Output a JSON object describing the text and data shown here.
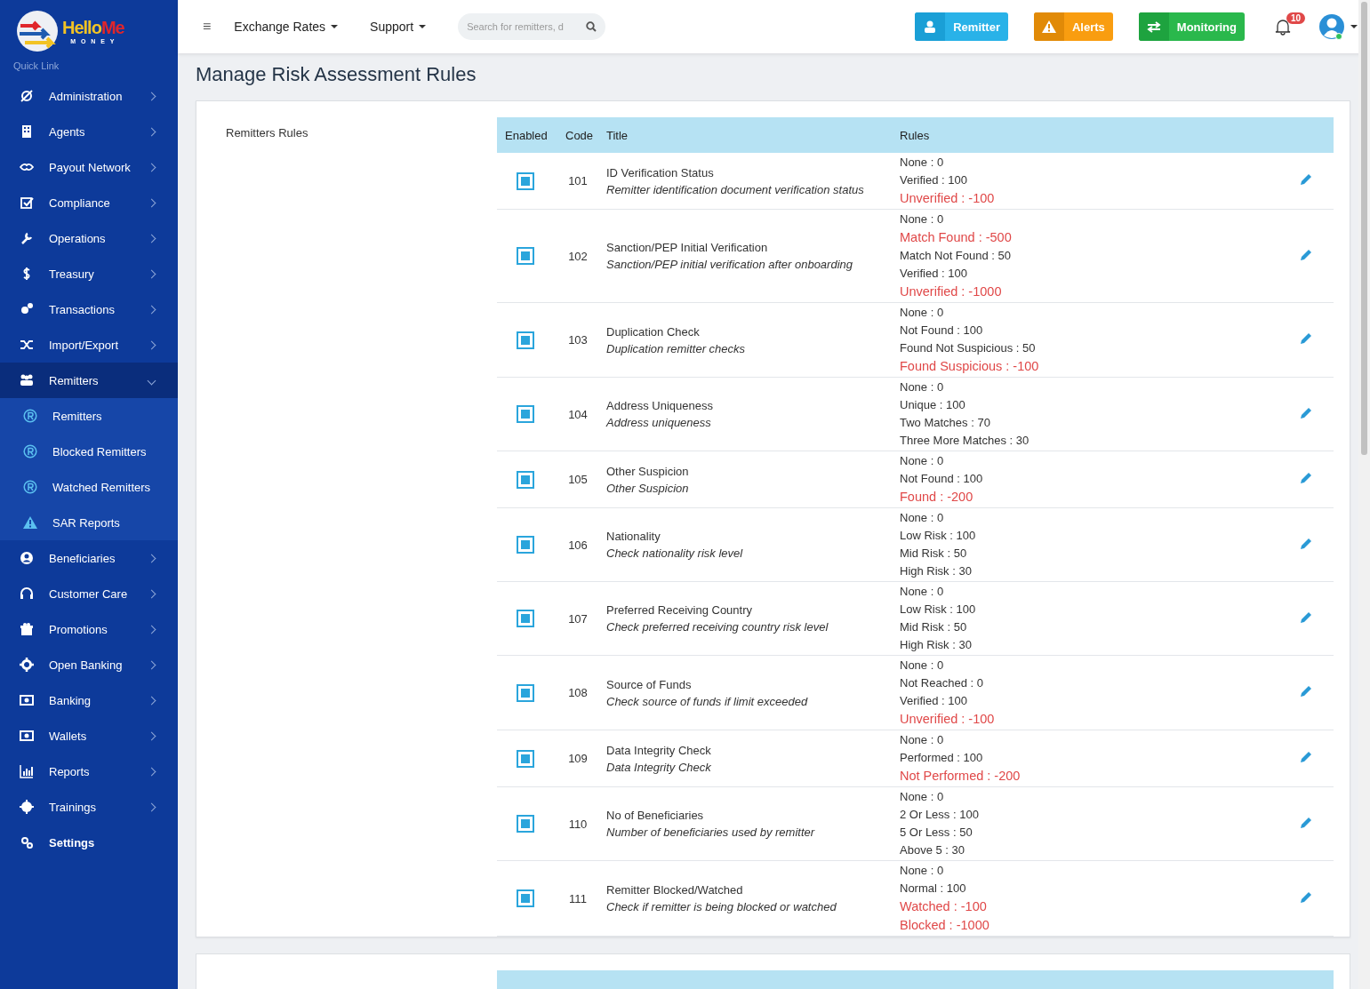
{
  "logo": {
    "name_part1": "Hello",
    "name_part2": "Me",
    "subtitle": "M O N E Y"
  },
  "sidebar": {
    "heading": "Quick Link",
    "items": [
      {
        "label": "Administration",
        "kind": "menu",
        "expanded": false
      },
      {
        "label": "Agents",
        "kind": "menu",
        "expanded": false
      },
      {
        "label": "Payout Network",
        "kind": "menu",
        "expanded": false
      },
      {
        "label": "Compliance",
        "kind": "menu",
        "expanded": false
      },
      {
        "label": "Operations",
        "kind": "menu",
        "expanded": false
      },
      {
        "label": "Treasury",
        "kind": "menu",
        "expanded": false
      },
      {
        "label": "Transactions",
        "kind": "menu",
        "expanded": false
      },
      {
        "label": "Import/Export",
        "kind": "menu",
        "expanded": false
      },
      {
        "label": "Remitters",
        "kind": "menu",
        "expanded": true,
        "children": [
          {
            "label": "Remitters",
            "kind": "registered"
          },
          {
            "label": "Blocked Remitters",
            "kind": "registered"
          },
          {
            "label": "Watched Remitters",
            "kind": "registered"
          },
          {
            "label": "SAR Reports",
            "kind": "warning"
          }
        ]
      },
      {
        "label": "Beneficiaries",
        "kind": "menu",
        "expanded": false
      },
      {
        "label": "Customer Care",
        "kind": "menu",
        "expanded": false
      },
      {
        "label": "Promotions",
        "kind": "menu",
        "expanded": false
      },
      {
        "label": "Open Banking",
        "kind": "menu",
        "expanded": false
      },
      {
        "label": "Banking",
        "kind": "menu",
        "expanded": false
      },
      {
        "label": "Wallets",
        "kind": "menu",
        "expanded": false
      },
      {
        "label": "Reports",
        "kind": "menu",
        "expanded": false
      },
      {
        "label": "Trainings",
        "kind": "menu",
        "expanded": false
      },
      {
        "label": "Settings",
        "kind": "link",
        "expanded": false
      }
    ]
  },
  "topbar": {
    "menu_glyph": "≡",
    "menus": [
      "Exchange Rates",
      "Support"
    ],
    "search": {
      "placeholder": "Search for remitters, d"
    },
    "buttons": [
      {
        "label": "Remitter",
        "kind": "person"
      },
      {
        "label": "Alerts",
        "kind": "warning"
      },
      {
        "label": "Monitoring",
        "kind": "exchange"
      }
    ],
    "notifications": "10"
  },
  "page_title": "Manage Risk Assessment Rules",
  "section": {
    "title": "Remitters Rules",
    "columns": [
      "Enabled",
      "Code",
      "Title",
      "Rules"
    ],
    "rows": [
      {
        "enabled": true,
        "code": "101",
        "title": "ID Verification Status",
        "description": "Remitter identification document verification status",
        "rules": [
          {
            "text": "None : 0",
            "kind": "normal"
          },
          {
            "text": "Verified : 100",
            "kind": "normal"
          },
          {
            "text": "Unverified : -100",
            "kind": "negative"
          }
        ]
      },
      {
        "enabled": true,
        "code": "102",
        "title": "Sanction/PEP Initial Verification",
        "description": "Sanction/PEP initial verification after onboarding",
        "rules": [
          {
            "text": "None : 0",
            "kind": "normal"
          },
          {
            "text": "Match Found : -500",
            "kind": "negative"
          },
          {
            "text": "Match Not Found : 50",
            "kind": "normal"
          },
          {
            "text": "Verified : 100",
            "kind": "normal"
          },
          {
            "text": "Unverified : -1000",
            "kind": "negative"
          }
        ]
      },
      {
        "enabled": true,
        "code": "103",
        "title": "Duplication Check",
        "description": "Duplication remitter checks",
        "rules": [
          {
            "text": "None : 0",
            "kind": "normal"
          },
          {
            "text": "Not Found : 100",
            "kind": "normal"
          },
          {
            "text": "Found Not Suspicious : 50",
            "kind": "normal"
          },
          {
            "text": "Found Suspicious : -100",
            "kind": "negative"
          }
        ]
      },
      {
        "enabled": true,
        "code": "104",
        "title": "Address Uniqueness",
        "description": "Address uniqueness",
        "rules": [
          {
            "text": "None : 0",
            "kind": "normal"
          },
          {
            "text": "Unique : 100",
            "kind": "normal"
          },
          {
            "text": "Two Matches : 70",
            "kind": "normal"
          },
          {
            "text": "Three More Matches : 30",
            "kind": "normal"
          }
        ]
      },
      {
        "enabled": true,
        "code": "105",
        "title": "Other Suspicion",
        "description": "Other Suspicion",
        "rules": [
          {
            "text": "None : 0",
            "kind": "normal"
          },
          {
            "text": "Not Found : 100",
            "kind": "normal"
          },
          {
            "text": "Found : -200",
            "kind": "negative"
          }
        ]
      },
      {
        "enabled": true,
        "code": "106",
        "title": "Nationality",
        "description": "Check nationality risk level",
        "rules": [
          {
            "text": "None : 0",
            "kind": "normal"
          },
          {
            "text": "Low Risk : 100",
            "kind": "normal"
          },
          {
            "text": "Mid Risk : 50",
            "kind": "normal"
          },
          {
            "text": "High Risk : 30",
            "kind": "normal"
          }
        ]
      },
      {
        "enabled": true,
        "code": "107",
        "title": "Preferred Receiving Country",
        "description": "Check preferred receiving country risk level",
        "rules": [
          {
            "text": "None : 0",
            "kind": "normal"
          },
          {
            "text": "Low Risk : 100",
            "kind": "normal"
          },
          {
            "text": "Mid Risk : 50",
            "kind": "normal"
          },
          {
            "text": "High Risk : 30",
            "kind": "normal"
          }
        ]
      },
      {
        "enabled": true,
        "code": "108",
        "title": "Source of Funds",
        "description": "Check source of funds if limit exceeded",
        "rules": [
          {
            "text": "None : 0",
            "kind": "normal"
          },
          {
            "text": "Not Reached : 0",
            "kind": "normal"
          },
          {
            "text": "Verified : 100",
            "kind": "normal"
          },
          {
            "text": "Unverified : -100",
            "kind": "negative"
          }
        ]
      },
      {
        "enabled": true,
        "code": "109",
        "title": "Data Integrity Check",
        "description": "Data Integrity Check",
        "rules": [
          {
            "text": "None : 0",
            "kind": "normal"
          },
          {
            "text": "Performed : 100",
            "kind": "normal"
          },
          {
            "text": "Not Performed : -200",
            "kind": "negative"
          }
        ]
      },
      {
        "enabled": true,
        "code": "110",
        "title": "No of Beneficiaries",
        "description": "Number of beneficiaries used by remitter",
        "rules": [
          {
            "text": "None : 0",
            "kind": "normal"
          },
          {
            "text": "2 Or Less : 100",
            "kind": "normal"
          },
          {
            "text": "5 Or Less : 50",
            "kind": "normal"
          },
          {
            "text": "Above 5 : 30",
            "kind": "normal"
          }
        ]
      },
      {
        "enabled": true,
        "code": "111",
        "title": "Remitter Blocked/Watched",
        "description": "Check if remitter is being blocked or watched",
        "rules": [
          {
            "text": "None : 0",
            "kind": "normal"
          },
          {
            "text": "Normal : 100",
            "kind": "normal"
          },
          {
            "text": "Watched : -100",
            "kind": "negative"
          },
          {
            "text": "Blocked : -1000",
            "kind": "negative"
          }
        ]
      }
    ]
  }
}
